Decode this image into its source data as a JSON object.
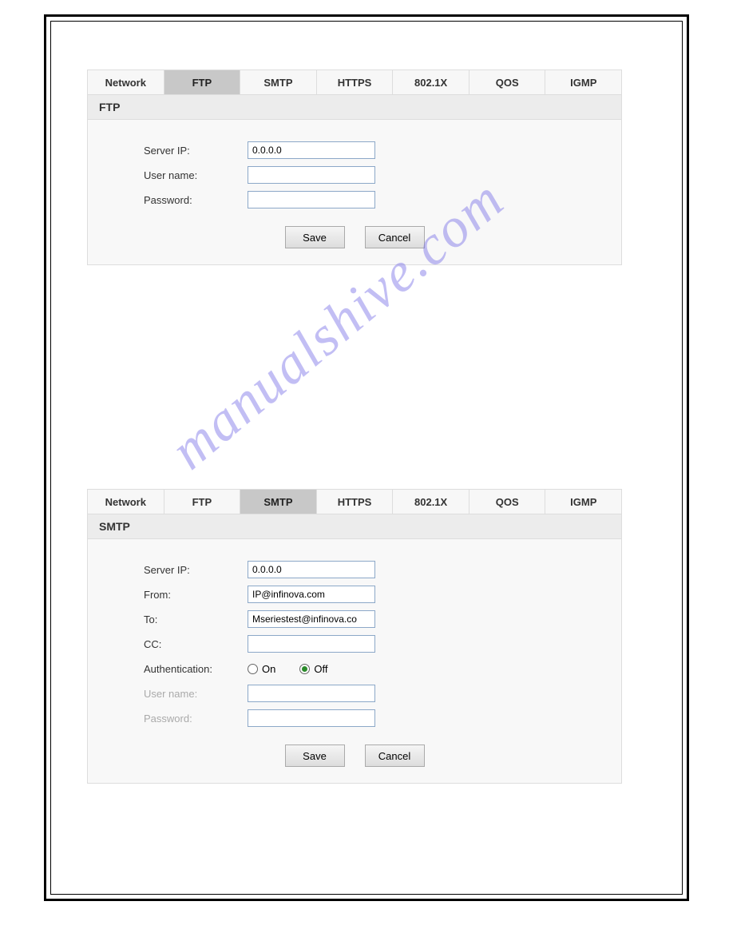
{
  "watermark": "manualshive.com",
  "tabs": {
    "network": "Network",
    "ftp": "FTP",
    "smtp": "SMTP",
    "https": "HTTPS",
    "8021x": "802.1X",
    "qos": "QOS",
    "igmp": "IGMP"
  },
  "ftp_panel": {
    "header": "FTP",
    "labels": {
      "server_ip": "Server IP:",
      "username": "User name:",
      "password": "Password:"
    },
    "values": {
      "server_ip": "0.0.0.0",
      "username": "",
      "password": ""
    }
  },
  "smtp_panel": {
    "header": "SMTP",
    "labels": {
      "server_ip": "Server IP:",
      "from": "From:",
      "to": "To:",
      "cc": "CC:",
      "auth": "Authentication:",
      "username": "User name:",
      "password": "Password:"
    },
    "values": {
      "server_ip": "0.0.0.0",
      "from": "IP@infinova.com",
      "to": "Mseriestest@infinova.co",
      "cc": ""
    },
    "auth_on": "On",
    "auth_off": "Off"
  },
  "buttons": {
    "save": "Save",
    "cancel": "Cancel"
  }
}
